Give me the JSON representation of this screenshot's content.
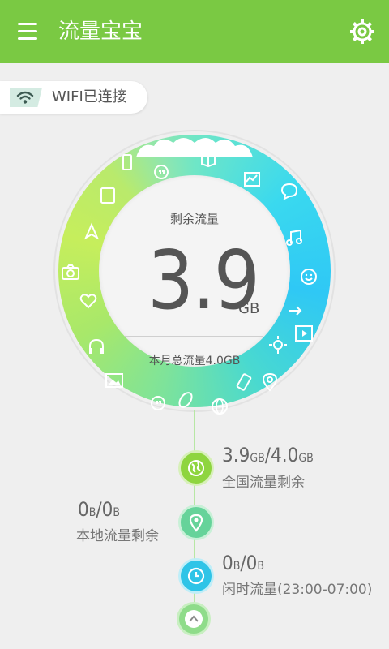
{
  "header": {
    "title": "流量宝宝",
    "menu_icon": "hamburger-icon",
    "settings_icon": "gear-icon"
  },
  "connection": {
    "label": "WIFI已连接",
    "icon": "wifi-icon"
  },
  "gauge": {
    "title": "剩余流量",
    "value": "3.9",
    "unit": "GB",
    "monthly_total": "本月总流量4.0GB",
    "fill_fraction": 0.975,
    "ring_icons": [
      "tablet-icon",
      "hangouts-icon",
      "book-icon",
      "chart-icon",
      "chat-icon",
      "triangle-icon",
      "music-icon",
      "smiley-icon",
      "camera-icon",
      "arrow-icon",
      "heart-icon",
      "video-icon",
      "sun-icon",
      "headphones-icon",
      "image-icon",
      "vibrate-icon",
      "location-icon",
      "quote-icon",
      "oval-icon",
      "globe-icon"
    ]
  },
  "stats": {
    "national": {
      "used": "3.9",
      "used_unit": "GB",
      "sep": "/",
      "total": "4.0",
      "total_unit": "GB",
      "label": "全国流量剩余"
    },
    "local": {
      "used": "0",
      "used_unit": "B",
      "sep": "/",
      "total": "0",
      "total_unit": "B",
      "label": "本地流量剩余"
    },
    "idle": {
      "used": "0",
      "used_unit": "B",
      "sep": "/",
      "total": "0",
      "total_unit": "B",
      "label": "闲时流量(23:00-07:00)"
    }
  },
  "colors": {
    "header": "#7ac943",
    "ring_green": "#a8e86a",
    "ring_blue": "#2fc8f5",
    "text": "#555555"
  }
}
